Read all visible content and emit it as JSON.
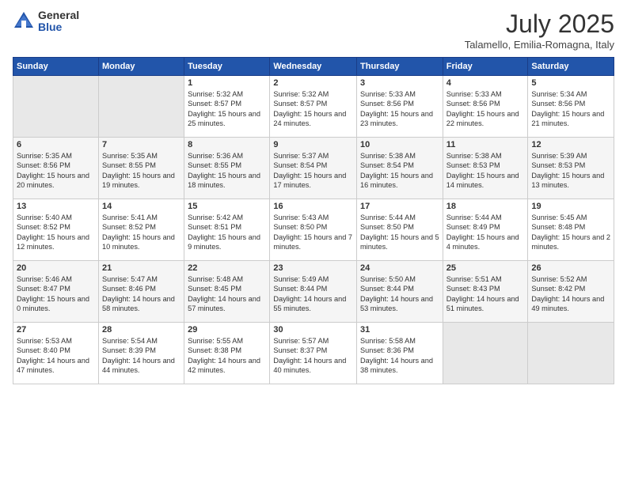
{
  "header": {
    "logo_general": "General",
    "logo_blue": "Blue",
    "title": "July 2025",
    "location": "Talamello, Emilia-Romagna, Italy"
  },
  "weekdays": [
    "Sunday",
    "Monday",
    "Tuesday",
    "Wednesday",
    "Thursday",
    "Friday",
    "Saturday"
  ],
  "weeks": [
    [
      {
        "day": "",
        "info": ""
      },
      {
        "day": "",
        "info": ""
      },
      {
        "day": "1",
        "info": "Sunrise: 5:32 AM\nSunset: 8:57 PM\nDaylight: 15 hours\nand 25 minutes."
      },
      {
        "day": "2",
        "info": "Sunrise: 5:32 AM\nSunset: 8:57 PM\nDaylight: 15 hours\nand 24 minutes."
      },
      {
        "day": "3",
        "info": "Sunrise: 5:33 AM\nSunset: 8:56 PM\nDaylight: 15 hours\nand 23 minutes."
      },
      {
        "day": "4",
        "info": "Sunrise: 5:33 AM\nSunset: 8:56 PM\nDaylight: 15 hours\nand 22 minutes."
      },
      {
        "day": "5",
        "info": "Sunrise: 5:34 AM\nSunset: 8:56 PM\nDaylight: 15 hours\nand 21 minutes."
      }
    ],
    [
      {
        "day": "6",
        "info": "Sunrise: 5:35 AM\nSunset: 8:56 PM\nDaylight: 15 hours\nand 20 minutes."
      },
      {
        "day": "7",
        "info": "Sunrise: 5:35 AM\nSunset: 8:55 PM\nDaylight: 15 hours\nand 19 minutes."
      },
      {
        "day": "8",
        "info": "Sunrise: 5:36 AM\nSunset: 8:55 PM\nDaylight: 15 hours\nand 18 minutes."
      },
      {
        "day": "9",
        "info": "Sunrise: 5:37 AM\nSunset: 8:54 PM\nDaylight: 15 hours\nand 17 minutes."
      },
      {
        "day": "10",
        "info": "Sunrise: 5:38 AM\nSunset: 8:54 PM\nDaylight: 15 hours\nand 16 minutes."
      },
      {
        "day": "11",
        "info": "Sunrise: 5:38 AM\nSunset: 8:53 PM\nDaylight: 15 hours\nand 14 minutes."
      },
      {
        "day": "12",
        "info": "Sunrise: 5:39 AM\nSunset: 8:53 PM\nDaylight: 15 hours\nand 13 minutes."
      }
    ],
    [
      {
        "day": "13",
        "info": "Sunrise: 5:40 AM\nSunset: 8:52 PM\nDaylight: 15 hours\nand 12 minutes."
      },
      {
        "day": "14",
        "info": "Sunrise: 5:41 AM\nSunset: 8:52 PM\nDaylight: 15 hours\nand 10 minutes."
      },
      {
        "day": "15",
        "info": "Sunrise: 5:42 AM\nSunset: 8:51 PM\nDaylight: 15 hours\nand 9 minutes."
      },
      {
        "day": "16",
        "info": "Sunrise: 5:43 AM\nSunset: 8:50 PM\nDaylight: 15 hours\nand 7 minutes."
      },
      {
        "day": "17",
        "info": "Sunrise: 5:44 AM\nSunset: 8:50 PM\nDaylight: 15 hours\nand 5 minutes."
      },
      {
        "day": "18",
        "info": "Sunrise: 5:44 AM\nSunset: 8:49 PM\nDaylight: 15 hours\nand 4 minutes."
      },
      {
        "day": "19",
        "info": "Sunrise: 5:45 AM\nSunset: 8:48 PM\nDaylight: 15 hours\nand 2 minutes."
      }
    ],
    [
      {
        "day": "20",
        "info": "Sunrise: 5:46 AM\nSunset: 8:47 PM\nDaylight: 15 hours\nand 0 minutes."
      },
      {
        "day": "21",
        "info": "Sunrise: 5:47 AM\nSunset: 8:46 PM\nDaylight: 14 hours\nand 58 minutes."
      },
      {
        "day": "22",
        "info": "Sunrise: 5:48 AM\nSunset: 8:45 PM\nDaylight: 14 hours\nand 57 minutes."
      },
      {
        "day": "23",
        "info": "Sunrise: 5:49 AM\nSunset: 8:44 PM\nDaylight: 14 hours\nand 55 minutes."
      },
      {
        "day": "24",
        "info": "Sunrise: 5:50 AM\nSunset: 8:44 PM\nDaylight: 14 hours\nand 53 minutes."
      },
      {
        "day": "25",
        "info": "Sunrise: 5:51 AM\nSunset: 8:43 PM\nDaylight: 14 hours\nand 51 minutes."
      },
      {
        "day": "26",
        "info": "Sunrise: 5:52 AM\nSunset: 8:42 PM\nDaylight: 14 hours\nand 49 minutes."
      }
    ],
    [
      {
        "day": "27",
        "info": "Sunrise: 5:53 AM\nSunset: 8:40 PM\nDaylight: 14 hours\nand 47 minutes."
      },
      {
        "day": "28",
        "info": "Sunrise: 5:54 AM\nSunset: 8:39 PM\nDaylight: 14 hours\nand 44 minutes."
      },
      {
        "day": "29",
        "info": "Sunrise: 5:55 AM\nSunset: 8:38 PM\nDaylight: 14 hours\nand 42 minutes."
      },
      {
        "day": "30",
        "info": "Sunrise: 5:57 AM\nSunset: 8:37 PM\nDaylight: 14 hours\nand 40 minutes."
      },
      {
        "day": "31",
        "info": "Sunrise: 5:58 AM\nSunset: 8:36 PM\nDaylight: 14 hours\nand 38 minutes."
      },
      {
        "day": "",
        "info": ""
      },
      {
        "day": "",
        "info": ""
      }
    ]
  ]
}
